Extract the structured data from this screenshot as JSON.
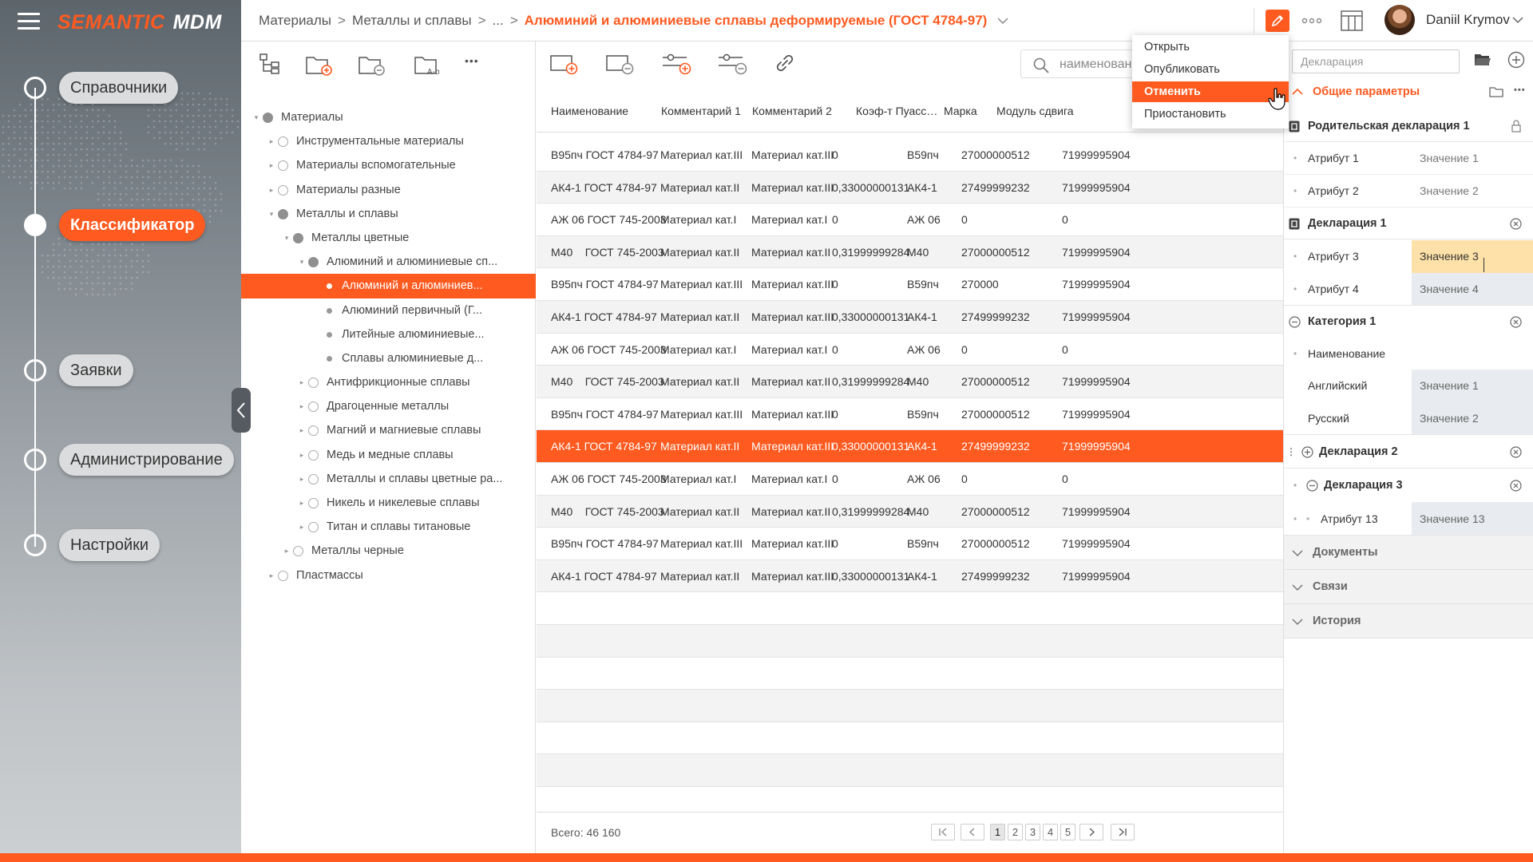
{
  "app": {
    "logo_part1": "SEMANTIC",
    "logo_part2": "MDM",
    "accent": "#ff5a20"
  },
  "nav": {
    "items": [
      {
        "label": "Справочники",
        "active": false
      },
      {
        "label": "Классификатор",
        "active": true
      },
      {
        "label": "Заявки",
        "active": false
      },
      {
        "label": "Администрирование",
        "active": false
      },
      {
        "label": "Настройки",
        "active": false
      }
    ]
  },
  "header": {
    "breadcrumb": [
      "Материалы",
      "Металлы и сплавы",
      "..."
    ],
    "current": "Алюминий и алюминиевые сплавы деформируемые (ГОСТ 4784-97)",
    "user_name": "Daniil Krymov"
  },
  "dropdown": {
    "items": [
      {
        "label": "Открыть",
        "highlighted": false
      },
      {
        "label": "Опубликовать",
        "highlighted": false
      },
      {
        "label": "Отменить",
        "highlighted": true
      },
      {
        "label": "Приостановить",
        "highlighted": false
      }
    ]
  },
  "tree": {
    "toolbar_icons": [
      "tree-structure-icon",
      "folder-add-icon",
      "folder-remove-icon",
      "folder-sort-icon",
      "more-icon"
    ],
    "sort_icon_text": "A-b",
    "more_text": "•••",
    "items": [
      {
        "label": "Материалы",
        "level": 0,
        "expand": "open",
        "dot": "filled",
        "selected": false
      },
      {
        "label": "Инструментальные материалы",
        "level": 1,
        "expand": "closed",
        "dot": "outline",
        "selected": false
      },
      {
        "label": "Материалы вспомогательные",
        "level": 1,
        "expand": "closed",
        "dot": "outline",
        "selected": false
      },
      {
        "label": "Материалы разные",
        "level": 1,
        "expand": "closed",
        "dot": "outline",
        "selected": false
      },
      {
        "label": "Металлы и сплавы",
        "level": 1,
        "expand": "open",
        "dot": "filled",
        "selected": false
      },
      {
        "label": "Металлы цветные",
        "level": 2,
        "expand": "open",
        "dot": "filled",
        "selected": false
      },
      {
        "label": "Алюминий и алюминиевые сп...",
        "level": 3,
        "expand": "open",
        "dot": "filled",
        "selected": false
      },
      {
        "label": "Алюминий и алюминиев...",
        "level": 4,
        "expand": "none",
        "dot": "small",
        "selected": true
      },
      {
        "label": "Алюминий первичный (Г...",
        "level": 4,
        "expand": "none",
        "dot": "small",
        "selected": false
      },
      {
        "label": "Литейные алюминиевые...",
        "level": 4,
        "expand": "none",
        "dot": "small",
        "selected": false
      },
      {
        "label": "Сплавы алюминиевые д...",
        "level": 4,
        "expand": "none",
        "dot": "small",
        "selected": false
      },
      {
        "label": "Антифрикционные сплавы",
        "level": 3,
        "expand": "closed",
        "dot": "outline",
        "selected": false
      },
      {
        "label": "Драгоценные металлы",
        "level": 3,
        "expand": "closed",
        "dot": "outline",
        "selected": false
      },
      {
        "label": "Магний и магниевые сплавы",
        "level": 3,
        "expand": "closed",
        "dot": "outline",
        "selected": false
      },
      {
        "label": "Медь и медные сплавы",
        "level": 3,
        "expand": "closed",
        "dot": "outline",
        "selected": false
      },
      {
        "label": "Металлы и сплавы цветные ра...",
        "level": 3,
        "expand": "closed",
        "dot": "outline",
        "selected": false
      },
      {
        "label": "Никель и никелевые сплавы",
        "level": 3,
        "expand": "closed",
        "dot": "outline",
        "selected": false
      },
      {
        "label": "Титан и сплавы титановые",
        "level": 3,
        "expand": "closed",
        "dot": "outline",
        "selected": false
      },
      {
        "label": "Металлы черные",
        "level": 2,
        "expand": "closed",
        "dot": "outline",
        "selected": false
      },
      {
        "label": "Пластмассы",
        "level": 1,
        "expand": "closed",
        "dot": "outline",
        "selected": false
      }
    ]
  },
  "grid": {
    "toolbar_icons": [
      "add-row-icon",
      "remove-row-icon",
      "add-filter-icon",
      "remove-filter-icon",
      "link-icon"
    ],
    "search_placeholder": "наименован",
    "columns": [
      "Наименование",
      "Комментарий 1",
      "Комментарий 2",
      "Коэф-т Пуассона",
      "Марка",
      "Модуль сдвига",
      ""
    ],
    "rows": [
      {
        "cells": [
          "В95пч ГОСТ 4784-97",
          "Материал кат.III",
          "Материал кат.III",
          "0",
          "В59пч",
          "27000000512",
          "71999995904"
        ]
      },
      {
        "cells": [
          "АК4-1 ГОСТ 4784-97",
          "Материал кат.II",
          "Материал кат.III",
          "0,33000000131",
          "АК4-1",
          "27499999232",
          "71999995904"
        ]
      },
      {
        "cells": [
          "АЖ 06 ГОСТ 745-2003",
          "Материал кат.I",
          "Материал кат.I",
          "0",
          "АЖ 06",
          "0",
          "0"
        ]
      },
      {
        "cells": [
          "М40    ГОСТ 745-2003",
          "Материал кат.II",
          "Материал кат.II",
          "0,31999999284",
          "М40",
          "27000000512",
          "71999995904"
        ]
      },
      {
        "cells": [
          "В95пч ГОСТ 4784-97",
          "Материал кат.III",
          "Материал кат.III",
          "0",
          "В59пч",
          "270000",
          "71999995904"
        ]
      },
      {
        "cells": [
          "АК4-1 ГОСТ 4784-97",
          "Материал кат.II",
          "Материал кат.III",
          "0,33000000131",
          "АК4-1",
          "27499999232",
          "71999995904"
        ]
      },
      {
        "cells": [
          "АЖ 06 ГОСТ 745-2003",
          "Материал кат.I",
          "Материал кат.I",
          "0",
          "АЖ 06",
          "0",
          "0"
        ]
      },
      {
        "cells": [
          "М40    ГОСТ 745-2003",
          "Материал кат.II",
          "Материал кат.II",
          "0,31999999284",
          "М40",
          "27000000512",
          "71999995904"
        ]
      },
      {
        "cells": [
          "В95пч ГОСТ 4784-97",
          "Материал кат.III",
          "Материал кат.III",
          "0",
          "В59пч",
          "27000000512",
          "71999995904"
        ]
      },
      {
        "cells": [
          "АК4-1 ГОСТ 4784-97",
          "Материал кат.II",
          "Материал кат.III",
          "0,33000000131",
          "АК4-1",
          "27499999232",
          "71999995904"
        ],
        "selected": true
      },
      {
        "cells": [
          "АЖ 06 ГОСТ 745-2003",
          "Материал кат.I",
          "Материал кат.I",
          "0",
          "АЖ 06",
          "0",
          "0"
        ]
      },
      {
        "cells": [
          "М40    ГОСТ 745-2003",
          "Материал кат.II",
          "Материал кат.II",
          "0,31999999284",
          "М40",
          "27000000512",
          "71999995904"
        ]
      },
      {
        "cells": [
          "В95пч ГОСТ 4784-97",
          "Материал кат.III",
          "Материал кат.III",
          "0",
          "В59пч",
          "27000000512",
          "71999995904"
        ]
      },
      {
        "cells": [
          "АК4-1 ГОСТ 4784-97",
          "Материал кат.II",
          "Материал кат.III",
          "0,33000000131",
          "АК4-1",
          "27499999232",
          "71999995904"
        ]
      }
    ],
    "total": "Всего: 46 160",
    "pages": [
      "1",
      "2",
      "3",
      "4",
      "5"
    ],
    "current_page": "1"
  },
  "right": {
    "input_placeholder": "Декларация",
    "general_title": "Общие параметры",
    "parent_decl": {
      "title": "Родительская декларация 1",
      "attrs": [
        {
          "k": "Атрибут 1",
          "v": "Значение 1"
        },
        {
          "k": "Атрибут 2",
          "v": "Значение 2"
        }
      ]
    },
    "decl1": {
      "title": "Декларация 1",
      "attrs": [
        {
          "k": "Атрибут 3",
          "v": "Значение 3"
        },
        {
          "k": "Атрибут 4",
          "v": "Значение 4"
        }
      ]
    },
    "cat1": {
      "title": "Категория 1",
      "name_label": "Наименование",
      "attrs": [
        {
          "k": "Английский",
          "v": "Значение 1"
        },
        {
          "k": "Русский",
          "v": "Значение 2"
        }
      ]
    },
    "decl2": {
      "title": "Декларация 2"
    },
    "decl3": {
      "title": "Декларация 3",
      "attrs": [
        {
          "k": "Атрибут 13",
          "v": "Значение 13"
        }
      ]
    },
    "sections": [
      "Документы",
      "Связи",
      "История"
    ],
    "more_text": "•••"
  }
}
